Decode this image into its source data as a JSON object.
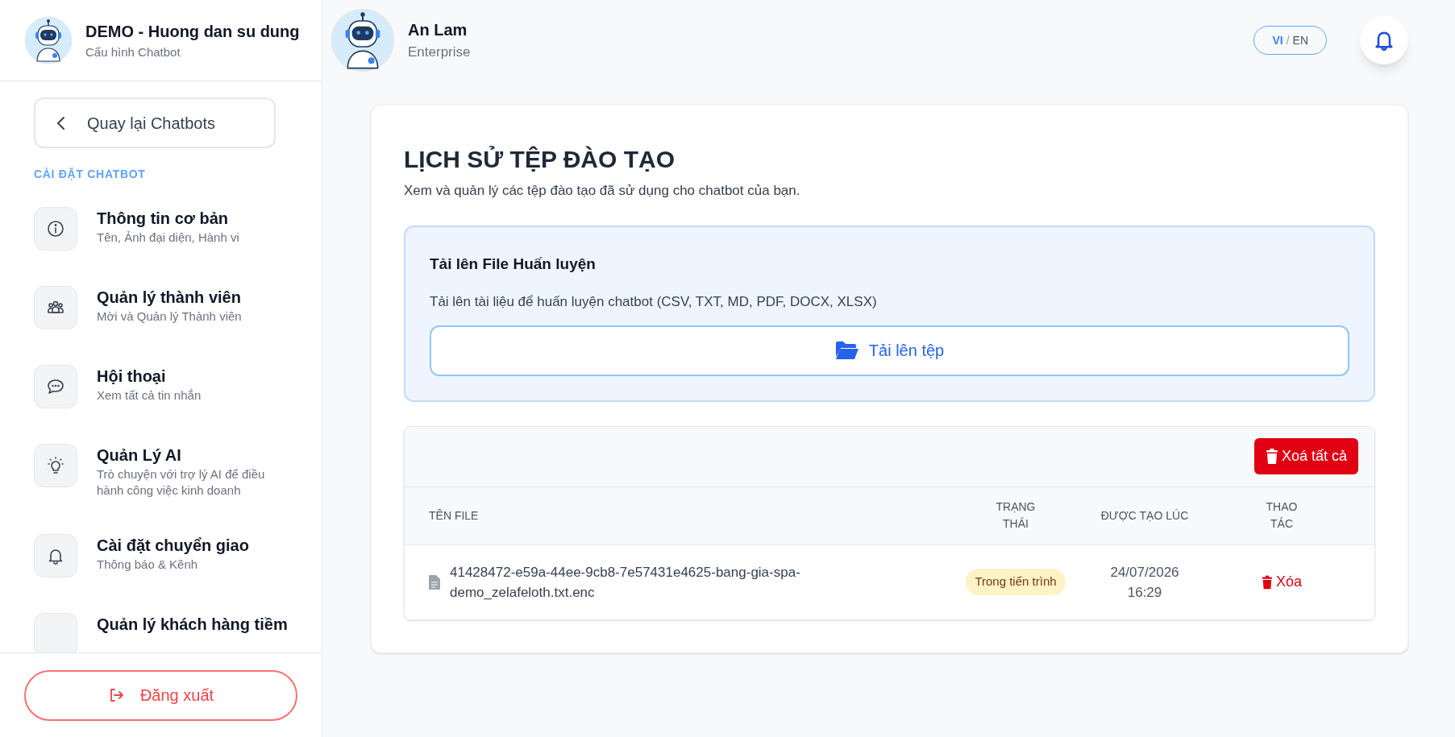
{
  "sidebar": {
    "bot_name": "DEMO - Huong dan su dung",
    "bot_subtitle": "Cấu hình Chatbot",
    "back_button": "Quay lại Chatbots",
    "section_label": "CÀI ĐẶT CHATBOT",
    "items": [
      {
        "title": "Thông tin cơ bản",
        "subtitle": "Tên, Ảnh đại diện, Hành vi"
      },
      {
        "title": "Quản lý thành viên",
        "subtitle": "Mời và Quản lý Thành viên"
      },
      {
        "title": "Hội thoại",
        "subtitle": "Xem tất cả tin nhắn"
      },
      {
        "title": "Quản Lý AI",
        "subtitle": "Trò chuyện với trợ lý AI để điều hành công việc kinh doanh"
      },
      {
        "title": "Cài đặt chuyển giao",
        "subtitle": "Thông báo & Kênh"
      },
      {
        "title": "Quản lý khách hàng tiềm"
      }
    ],
    "logout_button": "Đăng xuất"
  },
  "header": {
    "user_name": "An Lam",
    "plan": "Enterprise",
    "languages": [
      {
        "label": "VI",
        "selected": true
      },
      {
        "label": "EN",
        "selected": false
      }
    ],
    "language_separator": "/"
  },
  "page": {
    "title": "LỊCH SỬ TỆP ĐÀO TẠO",
    "description": "Xem và quản lý các tệp đào tạo đã sử dụng cho chatbot của bạn.",
    "upload": {
      "title": "Tải lên File Huấn luyện",
      "description": "Tải lên tài liệu để huấn luyện chatbot (CSV, TXT, MD, PDF, DOCX, XLSX)",
      "button": "Tải lên tệp"
    },
    "table": {
      "clear_all_button": "Xoá tất cả",
      "columns": [
        "TÊN FILE",
        "TRẠNG THÁI",
        "ĐƯỢC TẠO LÚC",
        "THAO TÁC"
      ],
      "rows": [
        {
          "file_name": "41428472-e59a-44ee-9cb8-7e57431e4625-bang-gia-spa-demo_zelafeloth.txt.enc",
          "status": "Trong tiến trình",
          "created_date": "24/07/2026",
          "created_time": "16:29",
          "action": "Xóa"
        }
      ]
    }
  }
}
